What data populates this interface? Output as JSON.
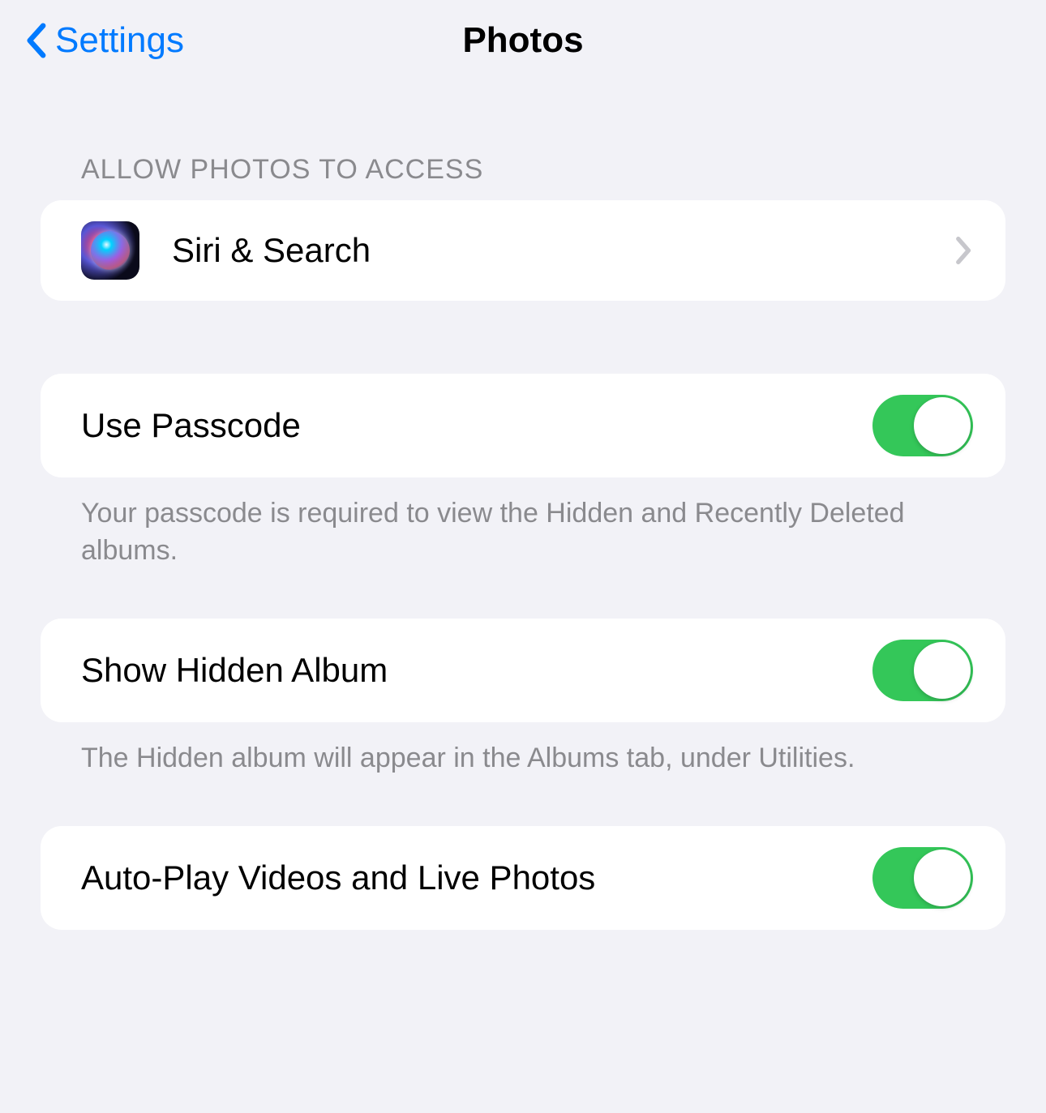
{
  "nav": {
    "back_label": "Settings",
    "title": "Photos"
  },
  "sections": {
    "access": {
      "header": "ALLOW PHOTOS TO ACCESS",
      "siri_search_label": "Siri & Search"
    },
    "passcode": {
      "label": "Use Passcode",
      "enabled": true,
      "footer": "Your passcode is required to view the Hidden and Recently Deleted albums."
    },
    "hidden_album": {
      "label": "Show Hidden Album",
      "enabled": true,
      "footer": "The Hidden album will appear in the Albums tab, under Utilities."
    },
    "autoplay": {
      "label": "Auto-Play Videos and Live Photos",
      "enabled": true
    }
  }
}
